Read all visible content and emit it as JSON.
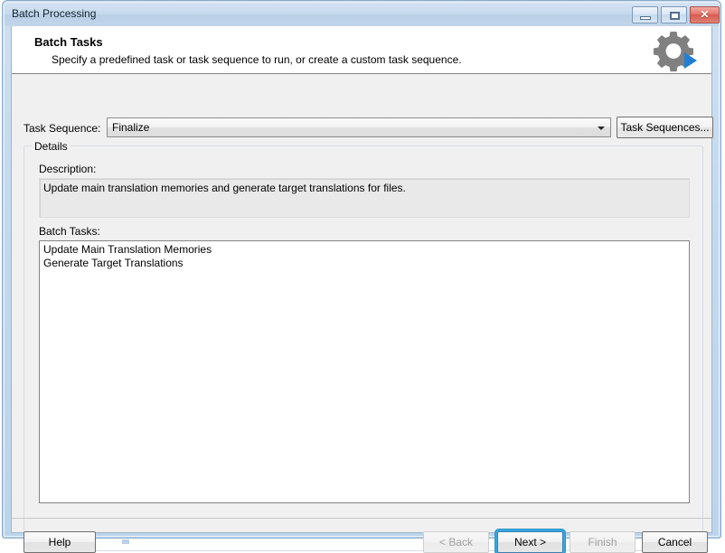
{
  "window": {
    "title": "Batch Processing",
    "caption_buttons": [
      {
        "name": "minimize",
        "glyph": "minimize-icon"
      },
      {
        "name": "maximize",
        "glyph": "maximize-icon"
      },
      {
        "name": "close",
        "glyph": "✕"
      }
    ]
  },
  "header": {
    "title": "Batch Tasks",
    "subtitle": "Specify a predefined task or task sequence to run, or create a custom task sequence.",
    "icon": "gear-icon"
  },
  "task_sequence": {
    "label": "Task Sequence:",
    "selected": "Finalize",
    "options": [
      "Finalize"
    ],
    "button_label": "Task Sequences...",
    "dropdown_icon": "chevron-down-icon"
  },
  "details": {
    "group_label": "Details",
    "description_label": "Description:",
    "description_text": "Update main translation memories and generate target translations for files.",
    "batch_tasks_label": "Batch Tasks:",
    "batch_tasks": [
      "Update Main Translation Memories",
      "Generate Target Translations"
    ]
  },
  "footer": {
    "help": "Help",
    "back": "< Back",
    "next": "Next >",
    "finish": "Finish",
    "cancel": "Cancel"
  },
  "colors": {
    "titlebar": "#c6d9ec",
    "client_bg": "#f0f0f0",
    "close_button": "#d75a4e",
    "focus_ring": "#32a9e0",
    "gear_gray": "#808080",
    "gear_arrow_blue": "#1e7fd4"
  }
}
